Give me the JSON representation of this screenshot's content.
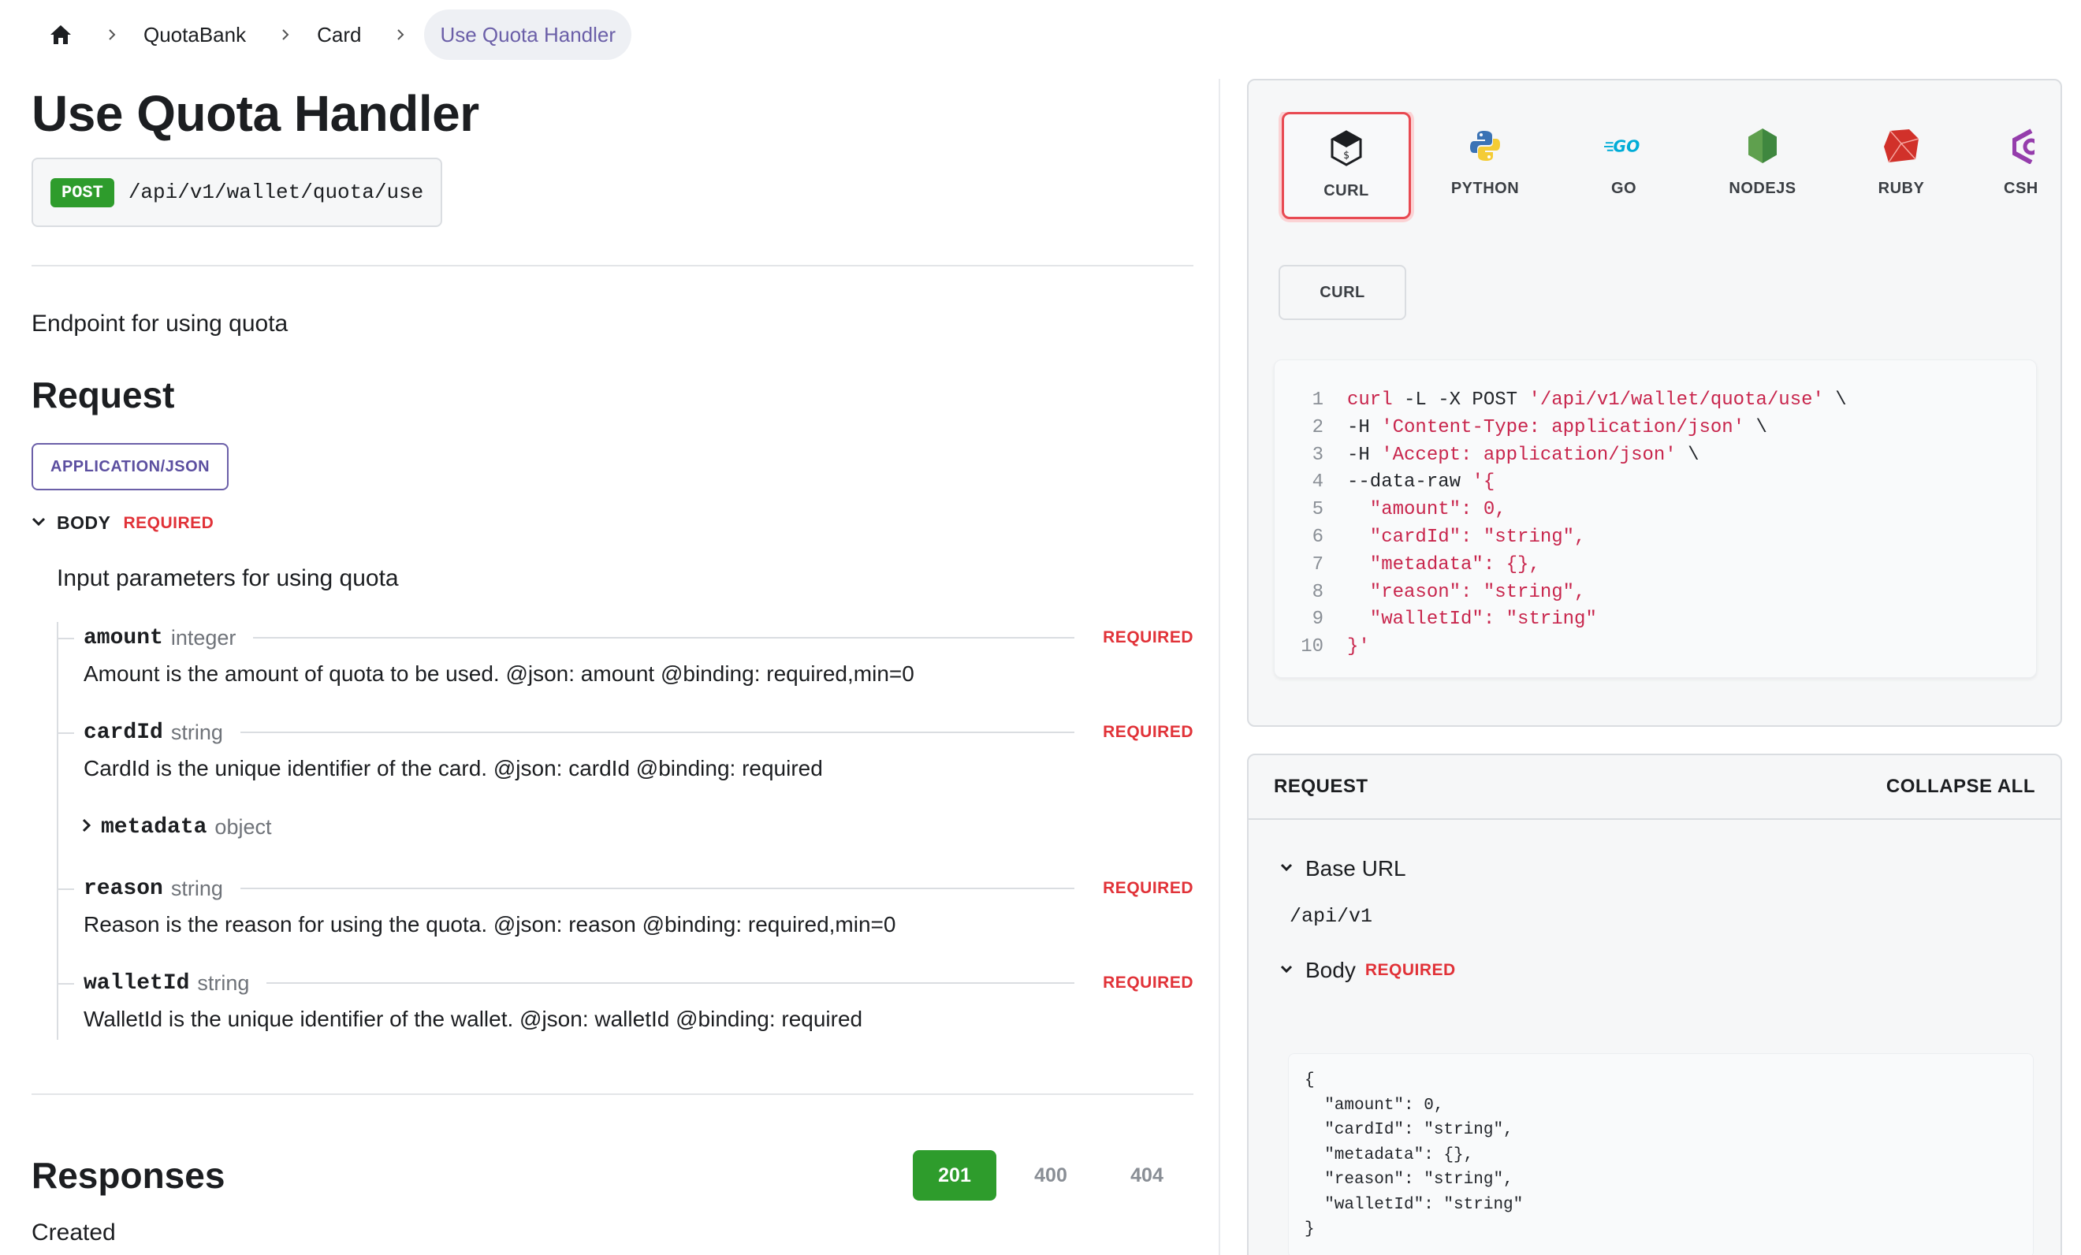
{
  "breadcrumb": {
    "items": [
      "QuotaBank",
      "Card"
    ],
    "current": "Use Quota Handler"
  },
  "page": {
    "title": "Use Quota Handler",
    "method": "POST",
    "path": "/api/v1/wallet/quota/use",
    "description": "Endpoint for using quota"
  },
  "request": {
    "heading": "Request",
    "mime": "APPLICATION/JSON",
    "body_label": "BODY",
    "required_label": "REQUIRED",
    "body_description": "Input parameters for using quota",
    "params": [
      {
        "name": "amount",
        "type": "integer",
        "required": "REQUIRED",
        "description": "Amount is the amount of quota to be used. @json: amount @binding: required,min=0"
      },
      {
        "name": "cardId",
        "type": "string",
        "required": "REQUIRED",
        "description": "CardId is the unique identifier of the card. @json: cardId @binding: required"
      },
      {
        "name": "metadata",
        "type": "object"
      },
      {
        "name": "reason",
        "type": "string",
        "required": "REQUIRED",
        "description": "Reason is the reason for using the quota. @json: reason @binding: required,min=0"
      },
      {
        "name": "walletId",
        "type": "string",
        "required": "REQUIRED",
        "description": "WalletId is the unique identifier of the wallet. @json: walletId @binding: required"
      }
    ]
  },
  "responses": {
    "heading": "Responses",
    "tabs": [
      "201",
      "400",
      "404"
    ],
    "active": "201",
    "partial_text": "Created"
  },
  "code_panel": {
    "languages": [
      "CURL",
      "PYTHON",
      "GO",
      "NODEJS",
      "RUBY",
      "CSH"
    ],
    "active_language": "CURL",
    "variant": "CURL",
    "lines": [
      {
        "n": "1",
        "parts": [
          [
            "s",
            "curl"
          ],
          [
            "c",
            " -L -X POST "
          ],
          [
            "s",
            "'/api/v1/wallet/quota/use'"
          ],
          [
            "c",
            " \\"
          ]
        ]
      },
      {
        "n": "2",
        "parts": [
          [
            "c",
            "-H "
          ],
          [
            "s",
            "'Content-Type: application/json'"
          ],
          [
            "c",
            " \\"
          ]
        ]
      },
      {
        "n": "3",
        "parts": [
          [
            "c",
            "-H "
          ],
          [
            "s",
            "'Accept: application/json'"
          ],
          [
            "c",
            " \\"
          ]
        ]
      },
      {
        "n": "4",
        "parts": [
          [
            "c",
            "--data-raw "
          ],
          [
            "s",
            "'{"
          ]
        ]
      },
      {
        "n": "5",
        "parts": [
          [
            "s",
            "  \"amount\": 0,"
          ]
        ]
      },
      {
        "n": "6",
        "parts": [
          [
            "s",
            "  \"cardId\": \"string\","
          ]
        ]
      },
      {
        "n": "7",
        "parts": [
          [
            "s",
            "  \"metadata\": {},"
          ]
        ]
      },
      {
        "n": "8",
        "parts": [
          [
            "s",
            "  \"reason\": \"string\","
          ]
        ]
      },
      {
        "n": "9",
        "parts": [
          [
            "s",
            "  \"walletId\": \"string\""
          ]
        ]
      },
      {
        "n": "10",
        "parts": [
          [
            "s",
            "}'"
          ]
        ]
      }
    ]
  },
  "request_panel": {
    "title": "REQUEST",
    "collapse_all": "COLLAPSE ALL",
    "base_url_label": "Base URL",
    "base_url": "/api/v1",
    "body_label": "Body",
    "required_label": "REQUIRED",
    "body_lines": [
      "{",
      "  \"amount\": 0,",
      "  \"cardId\": \"string\",",
      "  \"metadata\": {},",
      "  \"reason\": \"string\",",
      "  \"walletId\": \"string\"",
      "}"
    ]
  },
  "colors": {
    "post_green": "#2e9c2c",
    "required_red": "#e13238",
    "accent_purple": "#6b5fa8",
    "code_string": "#c8254c"
  }
}
